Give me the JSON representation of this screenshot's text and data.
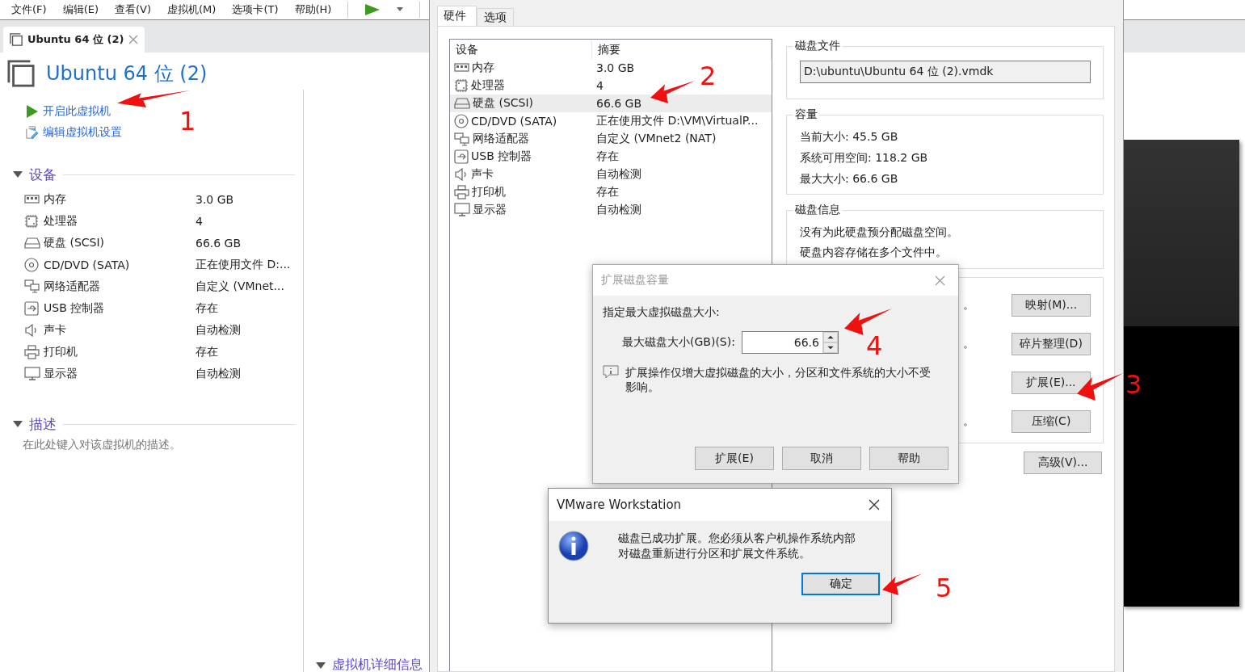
{
  "menu_bar": {
    "items": [
      "文件(F)",
      "编辑(E)",
      "查看(V)",
      "虚拟机(M)",
      "选项卡(T)",
      "帮助(H)"
    ]
  },
  "tabs": [
    {
      "label": "Ubuntu 64 位 (2)",
      "selected": true
    }
  ],
  "vm": {
    "title": "Ubuntu 64 位 (2)",
    "actions": [
      {
        "kind": "power-on",
        "label": "开启此虚拟机"
      },
      {
        "kind": "edit",
        "label": "编辑虚拟机设置"
      }
    ],
    "devices_section": {
      "title": "设备",
      "expanded": true,
      "items": [
        {
          "kind": "memory",
          "name": "内存",
          "value": "3.0 GB"
        },
        {
          "kind": "cpu",
          "name": "处理器",
          "value": "4"
        },
        {
          "kind": "disk",
          "name": "硬盘 (SCSI)",
          "value": "66.6 GB"
        },
        {
          "kind": "cdrom",
          "name": "CD/DVD (SATA)",
          "value": "正在使用文件 D:..."
        },
        {
          "kind": "network",
          "name": "网络适配器",
          "value": "自定义 (VMnet..."
        },
        {
          "kind": "usb",
          "name": "USB 控制器",
          "value": "存在"
        },
        {
          "kind": "sound",
          "name": "声卡",
          "value": "自动检测"
        },
        {
          "kind": "printer",
          "name": "打印机",
          "value": "存在"
        },
        {
          "kind": "display",
          "name": "显示器",
          "value": "自动检测"
        }
      ]
    },
    "description_section": {
      "title": "描述",
      "expanded": true,
      "placeholder": "在此处键入对该虚拟机的描述。"
    },
    "details_section": {
      "title": "虚拟机详细信息",
      "expanded": true
    }
  },
  "settings": {
    "tabs": [
      {
        "label": "硬件",
        "selected": true
      },
      {
        "label": "选项",
        "selected": false
      }
    ],
    "device_table": {
      "columns": [
        "设备",
        "摘要"
      ],
      "rows": [
        {
          "kind": "memory",
          "device": "内存",
          "summary": "3.0 GB",
          "selected": false
        },
        {
          "kind": "cpu",
          "device": "处理器",
          "summary": "4",
          "selected": false
        },
        {
          "kind": "disk",
          "device": "硬盘 (SCSI)",
          "summary": "66.6 GB",
          "selected": true
        },
        {
          "kind": "cdrom",
          "device": "CD/DVD (SATA)",
          "summary": "正在使用文件 D:\\VM\\VirtualP...",
          "selected": false
        },
        {
          "kind": "network",
          "device": "网络适配器",
          "summary": "自定义 (VMnet2 (NAT)",
          "selected": false
        },
        {
          "kind": "usb",
          "device": "USB 控制器",
          "summary": "存在",
          "selected": false
        },
        {
          "kind": "sound",
          "device": "声卡",
          "summary": "自动检测",
          "selected": false
        },
        {
          "kind": "printer",
          "device": "打印机",
          "summary": "存在",
          "selected": false
        },
        {
          "kind": "display",
          "device": "显示器",
          "summary": "自动检测",
          "selected": false
        }
      ]
    },
    "disk_file": {
      "title": "磁盘文件",
      "value": "D:\\ubuntu\\Ubuntu 64 位 (2).vmdk"
    },
    "capacity": {
      "title": "容量",
      "lines": [
        "当前大小: 45.5 GB",
        "系统可用空间: 118.2 GB",
        "最大大小: 66.6 GB"
      ]
    },
    "disk_info": {
      "title": "磁盘信息",
      "lines": [
        "没有为此硬盘预分配磁盘空间。",
        "硬盘内容存储在多个文件中。"
      ]
    },
    "disk_utilities": {
      "rows": [
        {
          "text": "。",
          "button": "映射(M)..."
        },
        {
          "text": "。",
          "button": "碎片整理(D)"
        },
        {
          "button": "扩展(E)..."
        },
        {
          "text": "。",
          "button": "压缩(C)"
        }
      ]
    },
    "advanced_button": "高级(V)..."
  },
  "expand_dialog": {
    "title": "扩展磁盘容量",
    "prompt": "指定最大虚拟磁盘大小:",
    "size_label": "最大磁盘大小(GB)(S):",
    "size_value": "66.6",
    "note": "扩展操作仅增大虚拟磁盘的大小，分区和文件系统的大小不受影响。",
    "buttons": [
      "扩展(E)",
      "取消",
      "帮助"
    ]
  },
  "message_box": {
    "title": "VMware Workstation",
    "message": "磁盘已成功扩展。您必须从客户机操作系统内部对磁盘重新进行分区和扩展文件系统。",
    "buttons": [
      {
        "label": "确定",
        "default": true
      }
    ]
  },
  "annotations": [
    {
      "label": "1"
    },
    {
      "label": "2"
    },
    {
      "label": "3"
    },
    {
      "label": "4"
    },
    {
      "label": "5"
    }
  ]
}
